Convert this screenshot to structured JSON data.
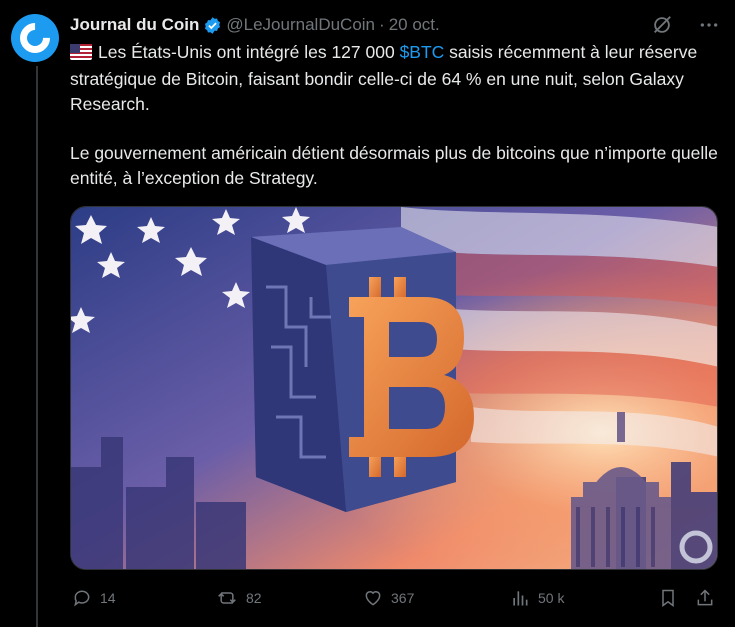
{
  "author": {
    "name": "Journal du Coin",
    "handle": "@LeJournalDuCoin",
    "date": "20 oct."
  },
  "tweet": {
    "p1_before": "Les États-Unis ont intégré les 127 000 ",
    "cashtag": "$BTC",
    "p1_after": " saisis récemment à leur réserve stratégique de Bitcoin, faisant bondir celle-ci de 64 % en une nuit, selon Galaxy Research.",
    "p2": "Le gouvernement américain détient désormais plus de bitcoins que n’importe quelle entité, à l’exception de Strategy."
  },
  "stats": {
    "replies": "14",
    "reposts": "82",
    "likes": "367",
    "views": "50 k"
  },
  "colors": {
    "link": "#1d9bf0",
    "muted": "#71767b",
    "background": "#000000",
    "text": "#e7e9ea"
  },
  "icons": [
    "journal-du-coin-logo",
    "verified-badge-icon",
    "grok-icon",
    "more-icon",
    "us-flag-emoji",
    "reply-icon",
    "repost-icon",
    "like-icon",
    "views-icon",
    "bookmark-icon",
    "share-icon"
  ]
}
